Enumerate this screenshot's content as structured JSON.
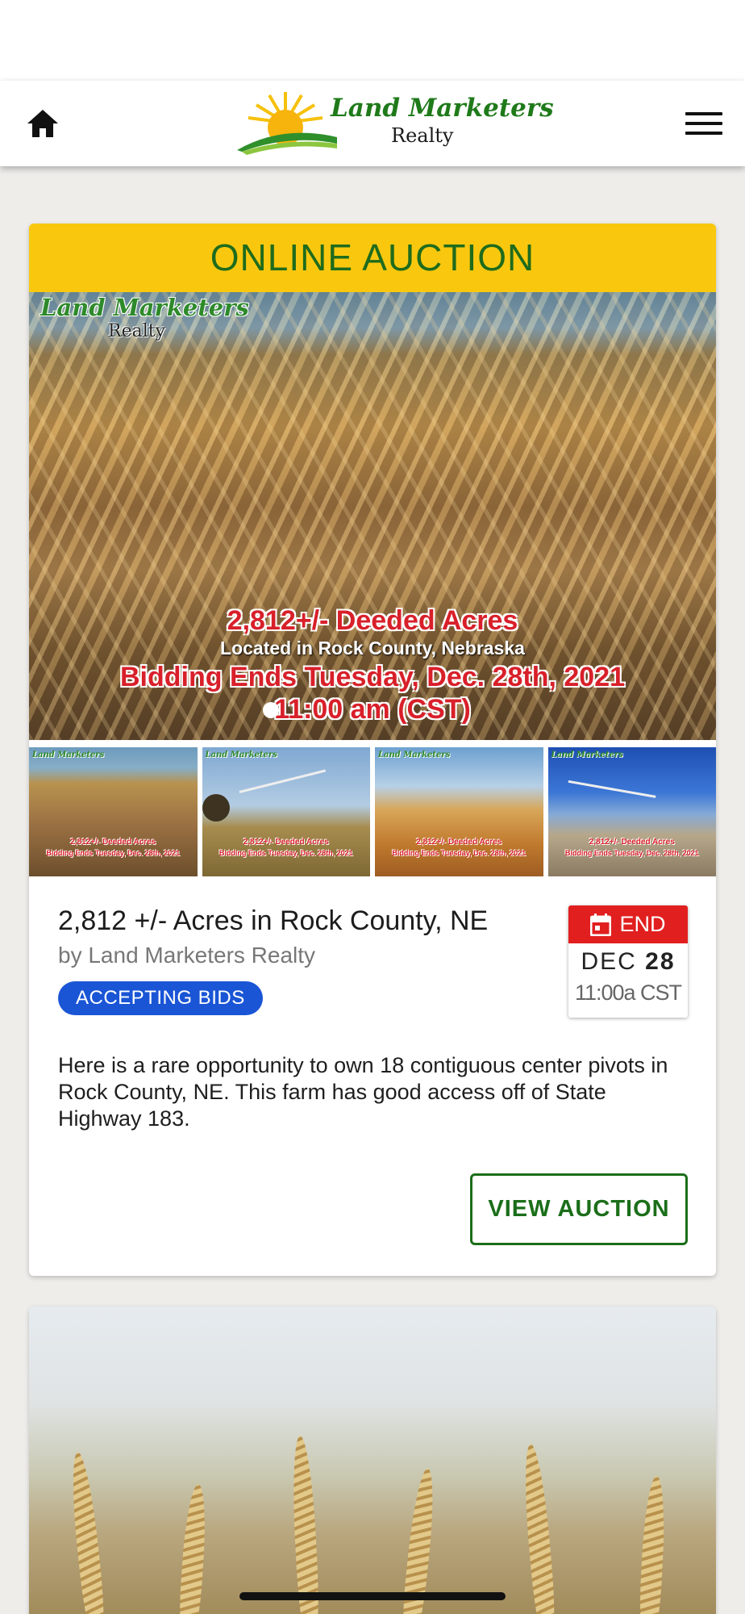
{
  "header": {
    "home_icon": "home-icon",
    "menu_icon": "hamburger-menu-icon",
    "logo": {
      "line1": "Land Marketers",
      "line2": "Realty"
    }
  },
  "listing": {
    "banner": "ONLINE AUCTION",
    "hero": {
      "logo_line1": "Land Marketers",
      "logo_line2": "Realty",
      "line1": "2,812+/- Deeded Acres",
      "line2": "Located in Rock County, Nebraska",
      "line3": "Bidding Ends Tuesday, Dec. 28th, 2021",
      "line4": "11:00 am (CST)"
    },
    "thumbnails": [
      {
        "logo": "Land Marketers",
        "cap1": "2,812+/- Deeded Acres",
        "cap2": "Bidding Ends Tuesday, Dec. 28th, 2021"
      },
      {
        "logo": "Land Marketers",
        "cap1": "2,812+/- Deeded Acres",
        "cap2": "Bidding Ends Tuesday, Dec. 28th, 2021"
      },
      {
        "logo": "Land Marketers",
        "cap1": "2,812+/- Deeded Acres",
        "cap2": "Bidding Ends Tuesday, Dec. 28th, 2021"
      },
      {
        "logo": "Land Marketers",
        "cap1": "2,812+/- Deeded Acres",
        "cap2": "Bidding Ends Tuesday, Dec. 28th, 2021"
      }
    ],
    "title": "2,812 +/- Acres in Rock County, NE",
    "by": "by Land Marketers Realty",
    "status": "ACCEPTING BIDS",
    "end": {
      "label": "END",
      "month": "DEC",
      "day": "28",
      "time": "11:00a CST"
    },
    "description": "Here is a rare opportunity to own 18 contiguous center pivots in Rock County, NE. This farm has good access off of State Highway 183.",
    "button": "VIEW AUCTION"
  },
  "colors": {
    "banner_bg": "#f9c80e",
    "brand_green": "#1b6e19",
    "status_blue": "#1a55d6",
    "end_red": "#e11f1f"
  }
}
